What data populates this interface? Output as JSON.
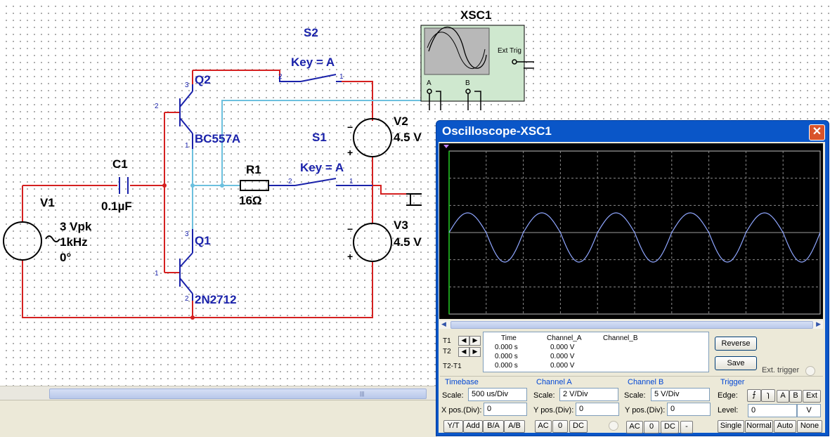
{
  "schematic": {
    "scope_label": "XSC1",
    "scope_ext_trig": "Ext Trig",
    "scope_a": "A",
    "scope_b": "B",
    "s2_name": "S2",
    "s2_key": "Key = A",
    "s1_name": "S1",
    "s1_key": "Key = A",
    "q2_name": "Q2",
    "q2_part": "BC557A",
    "q1_name": "Q1",
    "q1_part": "2N2712",
    "c1_name": "C1",
    "c1_value": "0.1µF",
    "r1_name": "R1",
    "r1_value": "16Ω",
    "v1_name": "V1",
    "v1_amp": "3 Vpk",
    "v1_freq": "1kHz",
    "v1_phase": "0°",
    "v2_name": "V2",
    "v2_value": "4.5 V",
    "v3_name": "V3",
    "v3_value": "4.5 V",
    "wire_red": "#d42020",
    "wire_blue": "#6cc0de",
    "wire_navy": "#1a22aa"
  },
  "oscilloscope": {
    "title": "Oscilloscope-XSC1",
    "close_icon": "close-icon",
    "trace_color": "#8fa6ff",
    "readout": {
      "t1": "T1",
      "t2": "T2",
      "t2t1": "T2-T1",
      "headers": [
        "Time",
        "Channel_A",
        "Channel_B"
      ],
      "rows": [
        [
          "0.000 s",
          "0.000 V"
        ],
        [
          "0.000 s",
          "0.000 V"
        ],
        [
          "0.000 s",
          "0.000 V"
        ]
      ]
    },
    "reverse_label": "Reverse",
    "save_label": "Save",
    "ext_trigger_label": "Ext. trigger",
    "timebase": {
      "title": "Timebase",
      "scale_label": "Scale:",
      "scale_value": "500 us/Div",
      "xpos_label": "X pos.(Div):",
      "xpos_value": "0",
      "buttons": [
        "Y/T",
        "Add",
        "B/A",
        "A/B"
      ]
    },
    "channel_a": {
      "title": "Channel A",
      "scale_label": "Scale:",
      "scale_value": "2  V/Div",
      "ypos_label": "Y pos.(Div):",
      "ypos_value": "0",
      "buttons": [
        "AC",
        "0",
        "DC"
      ]
    },
    "channel_b": {
      "title": "Channel B",
      "scale_label": "Scale:",
      "scale_value": "5  V/Div",
      "ypos_label": "Y pos.(Div):",
      "ypos_value": "0",
      "buttons": [
        "AC",
        "0",
        "DC",
        "-"
      ]
    },
    "trigger": {
      "title": "Trigger",
      "edge_label": "Edge:",
      "edge_buttons": [
        "A",
        "B",
        "Ext"
      ],
      "level_label": "Level:",
      "level_value": "0",
      "level_unit": "V",
      "mode_buttons": [
        "Single",
        "Normal",
        "Auto",
        "None"
      ]
    }
  }
}
